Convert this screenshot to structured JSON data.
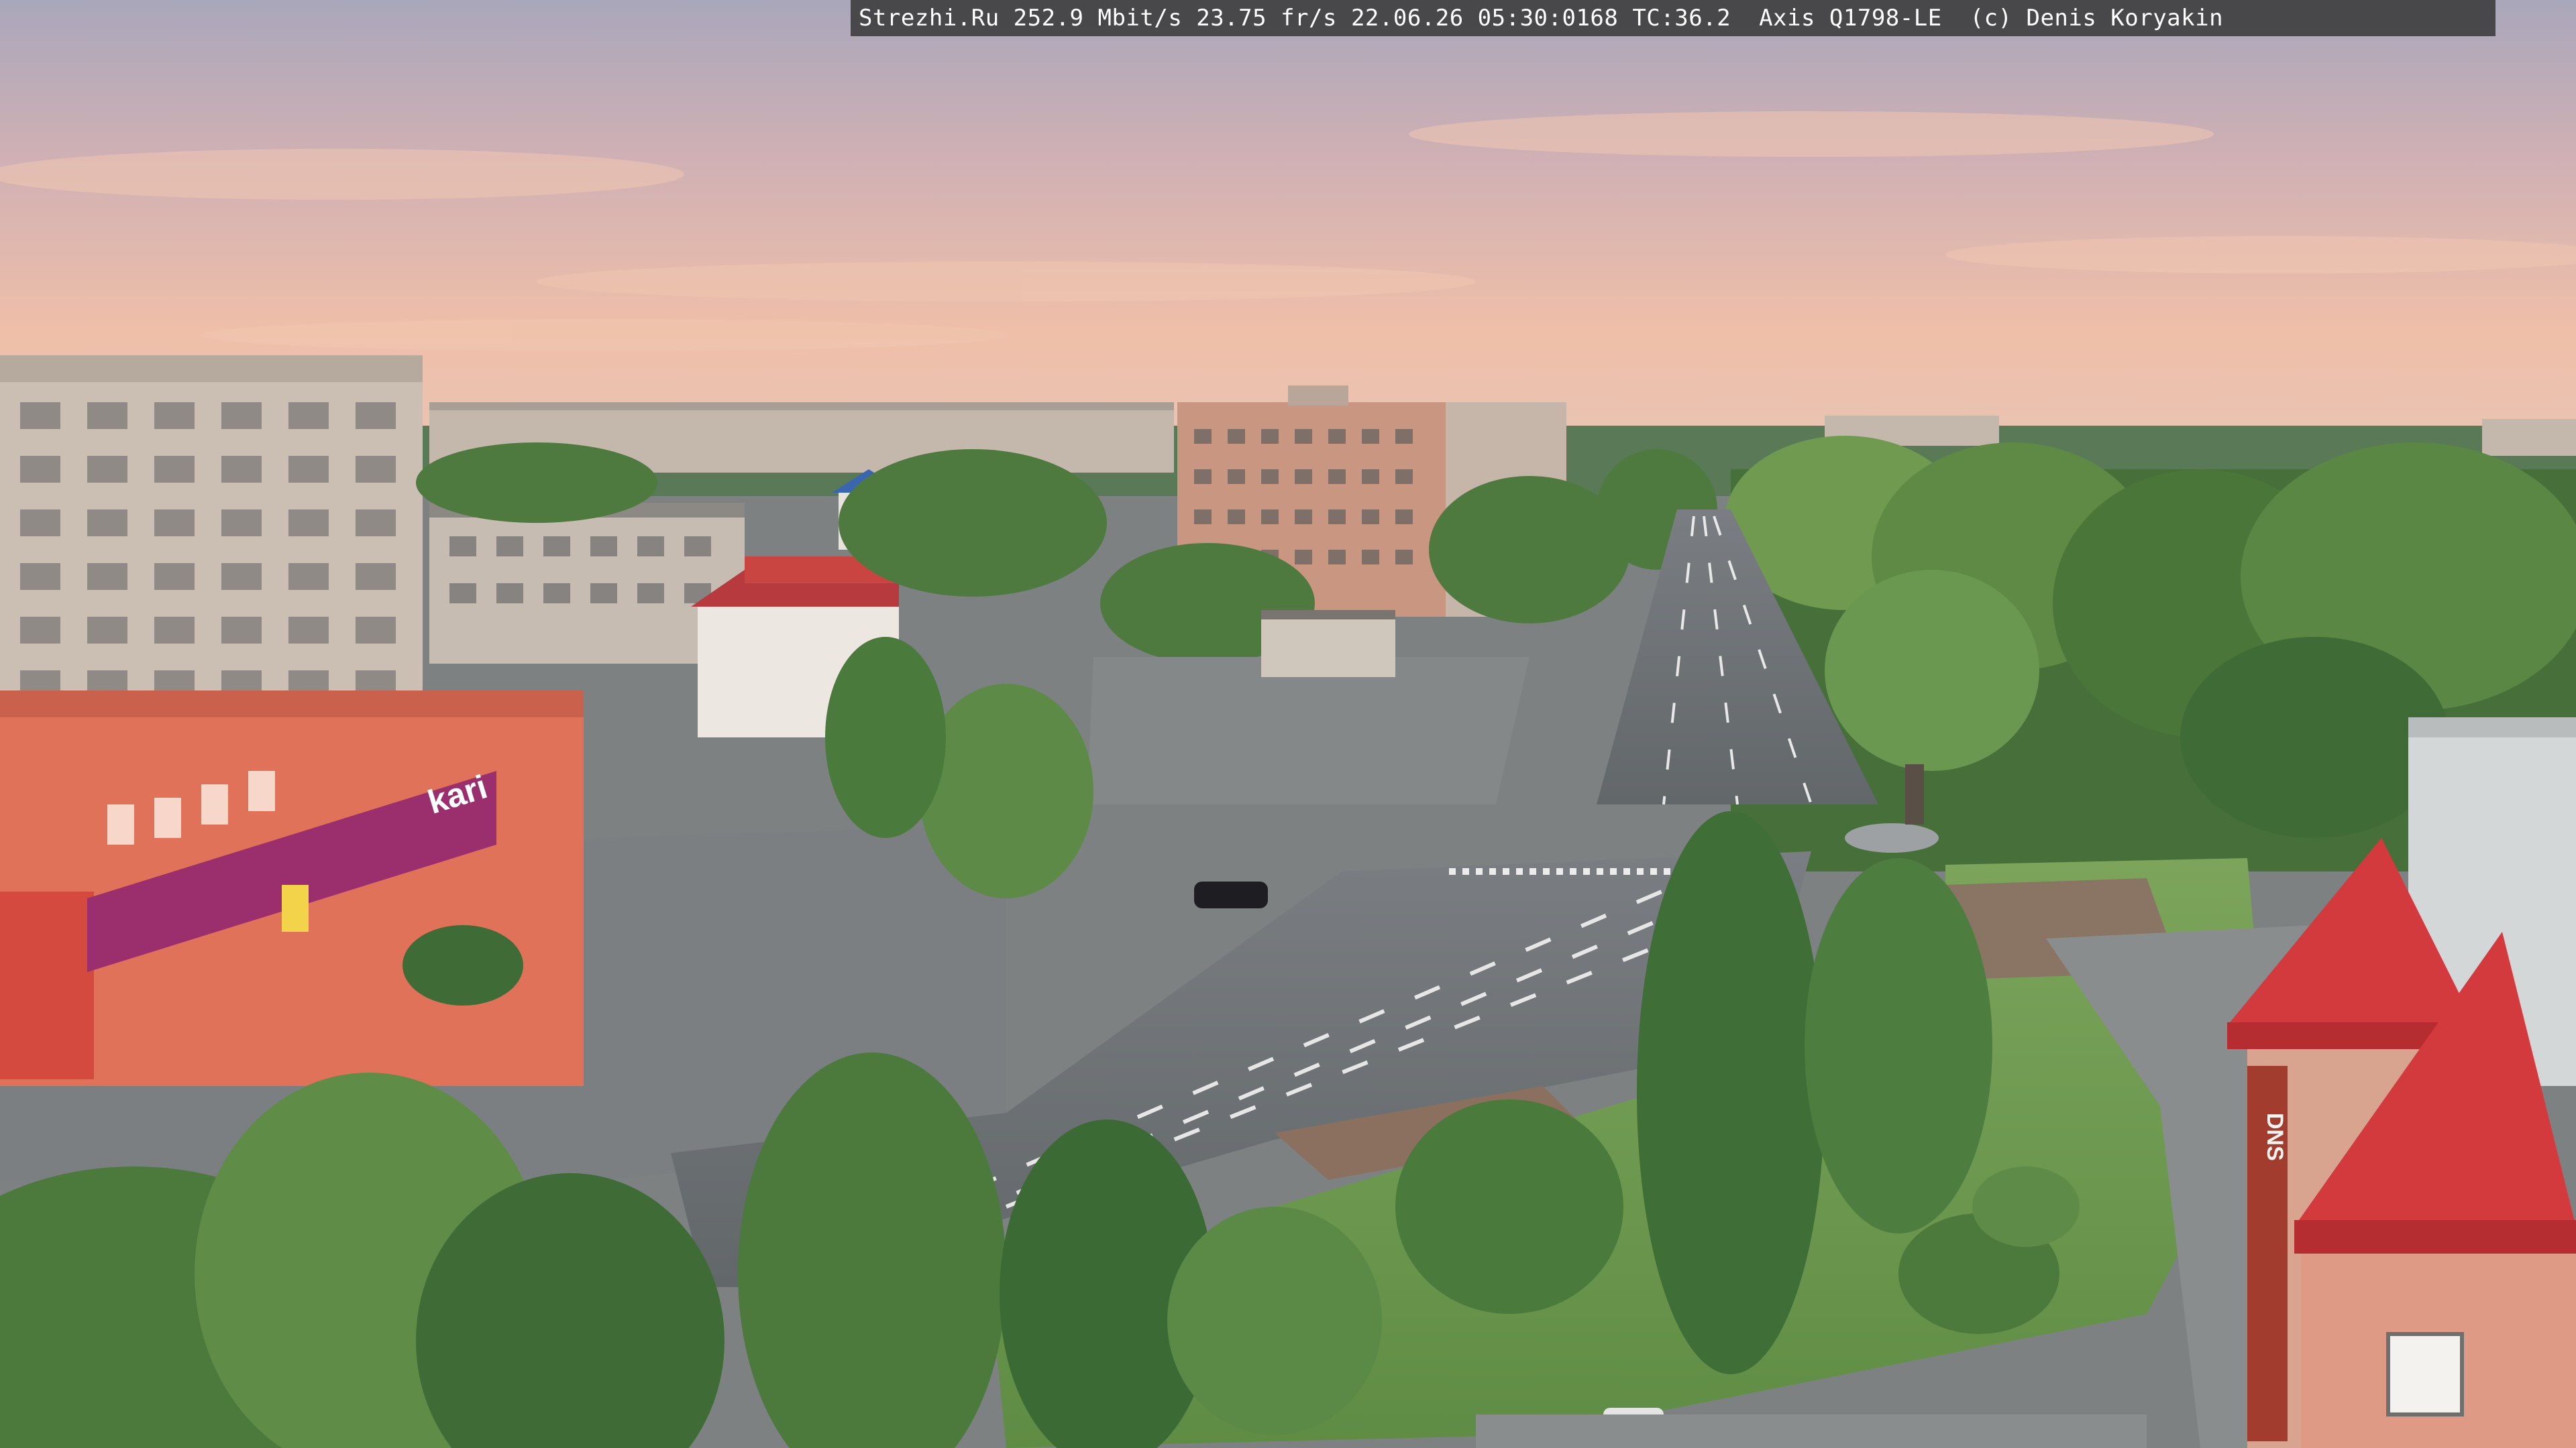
{
  "overlay": {
    "osd_text": "Strezhi.Ru 252.9 Mbit/s 23.75 fr/s 22.06.26 05:30:0168 TC:36.2  Axis Q1798-LE  (c) Denis Koryakin"
  },
  "signs": {
    "store_brand": "kari",
    "tower_banner": "DNS"
  },
  "colors": {
    "sky_top": "#b7a7b5",
    "sky_glow": "#f2c0a8",
    "road": "#6f7477",
    "plaza": "#7b7e80",
    "grass": "#6f9a4e",
    "tree_dark": "#3f6b36",
    "tree_light": "#6e9a52",
    "building_panel": "#c9bdb3",
    "brick": "#c9927e",
    "store_orange": "#e0725a",
    "store_banner": "#9b2f6e",
    "roof_red": "#d33a3e"
  }
}
